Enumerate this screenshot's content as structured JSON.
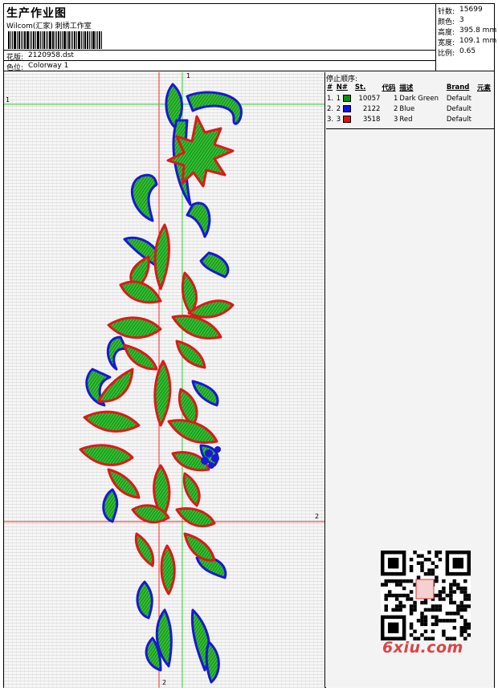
{
  "header": {
    "title": "生产作业图",
    "company": "Wilcom(汇家) 刺绣工作室",
    "pattern_label": "花版:",
    "pattern_value": "2120958.dst",
    "colorway_label": "色位:",
    "colorway_value": "Colorway 1"
  },
  "specs": [
    {
      "label": "针数:",
      "value": "15699"
    },
    {
      "label": "颜色:",
      "value": "3"
    },
    {
      "label": "高度:",
      "value": "395.8 mm"
    },
    {
      "label": "宽度:",
      "value": "109.1 mm"
    },
    {
      "label": "比例:",
      "value": "0.65"
    }
  ],
  "stop_sequence": {
    "title": "停止顺序:",
    "columns": [
      "#",
      "N#",
      "St.",
      "代码",
      "描述",
      "Brand",
      "元素"
    ],
    "rows": [
      {
        "idx": "1.",
        "n": "1",
        "color": "#0a8f0a",
        "stitches": "10057",
        "code": "1",
        "desc": "Dark Green",
        "brand": "Default"
      },
      {
        "idx": "2.",
        "n": "2",
        "color": "#1010e0",
        "stitches": "2122",
        "code": "2",
        "desc": "Blue",
        "brand": "Default"
      },
      {
        "idx": "3.",
        "n": "3",
        "color": "#e01010",
        "stitches": "3518",
        "code": "3",
        "desc": "Red",
        "brand": "Default"
      }
    ]
  },
  "guides": {
    "h1": "1",
    "v1": "1",
    "h2": "2",
    "v2": "2"
  },
  "watermark": "6xiu.com",
  "colors": {
    "green": "#1aa41a",
    "blue": "#1818d8",
    "red": "#e01818",
    "guide_red": "#ff2020",
    "guide_green": "#30d030"
  }
}
